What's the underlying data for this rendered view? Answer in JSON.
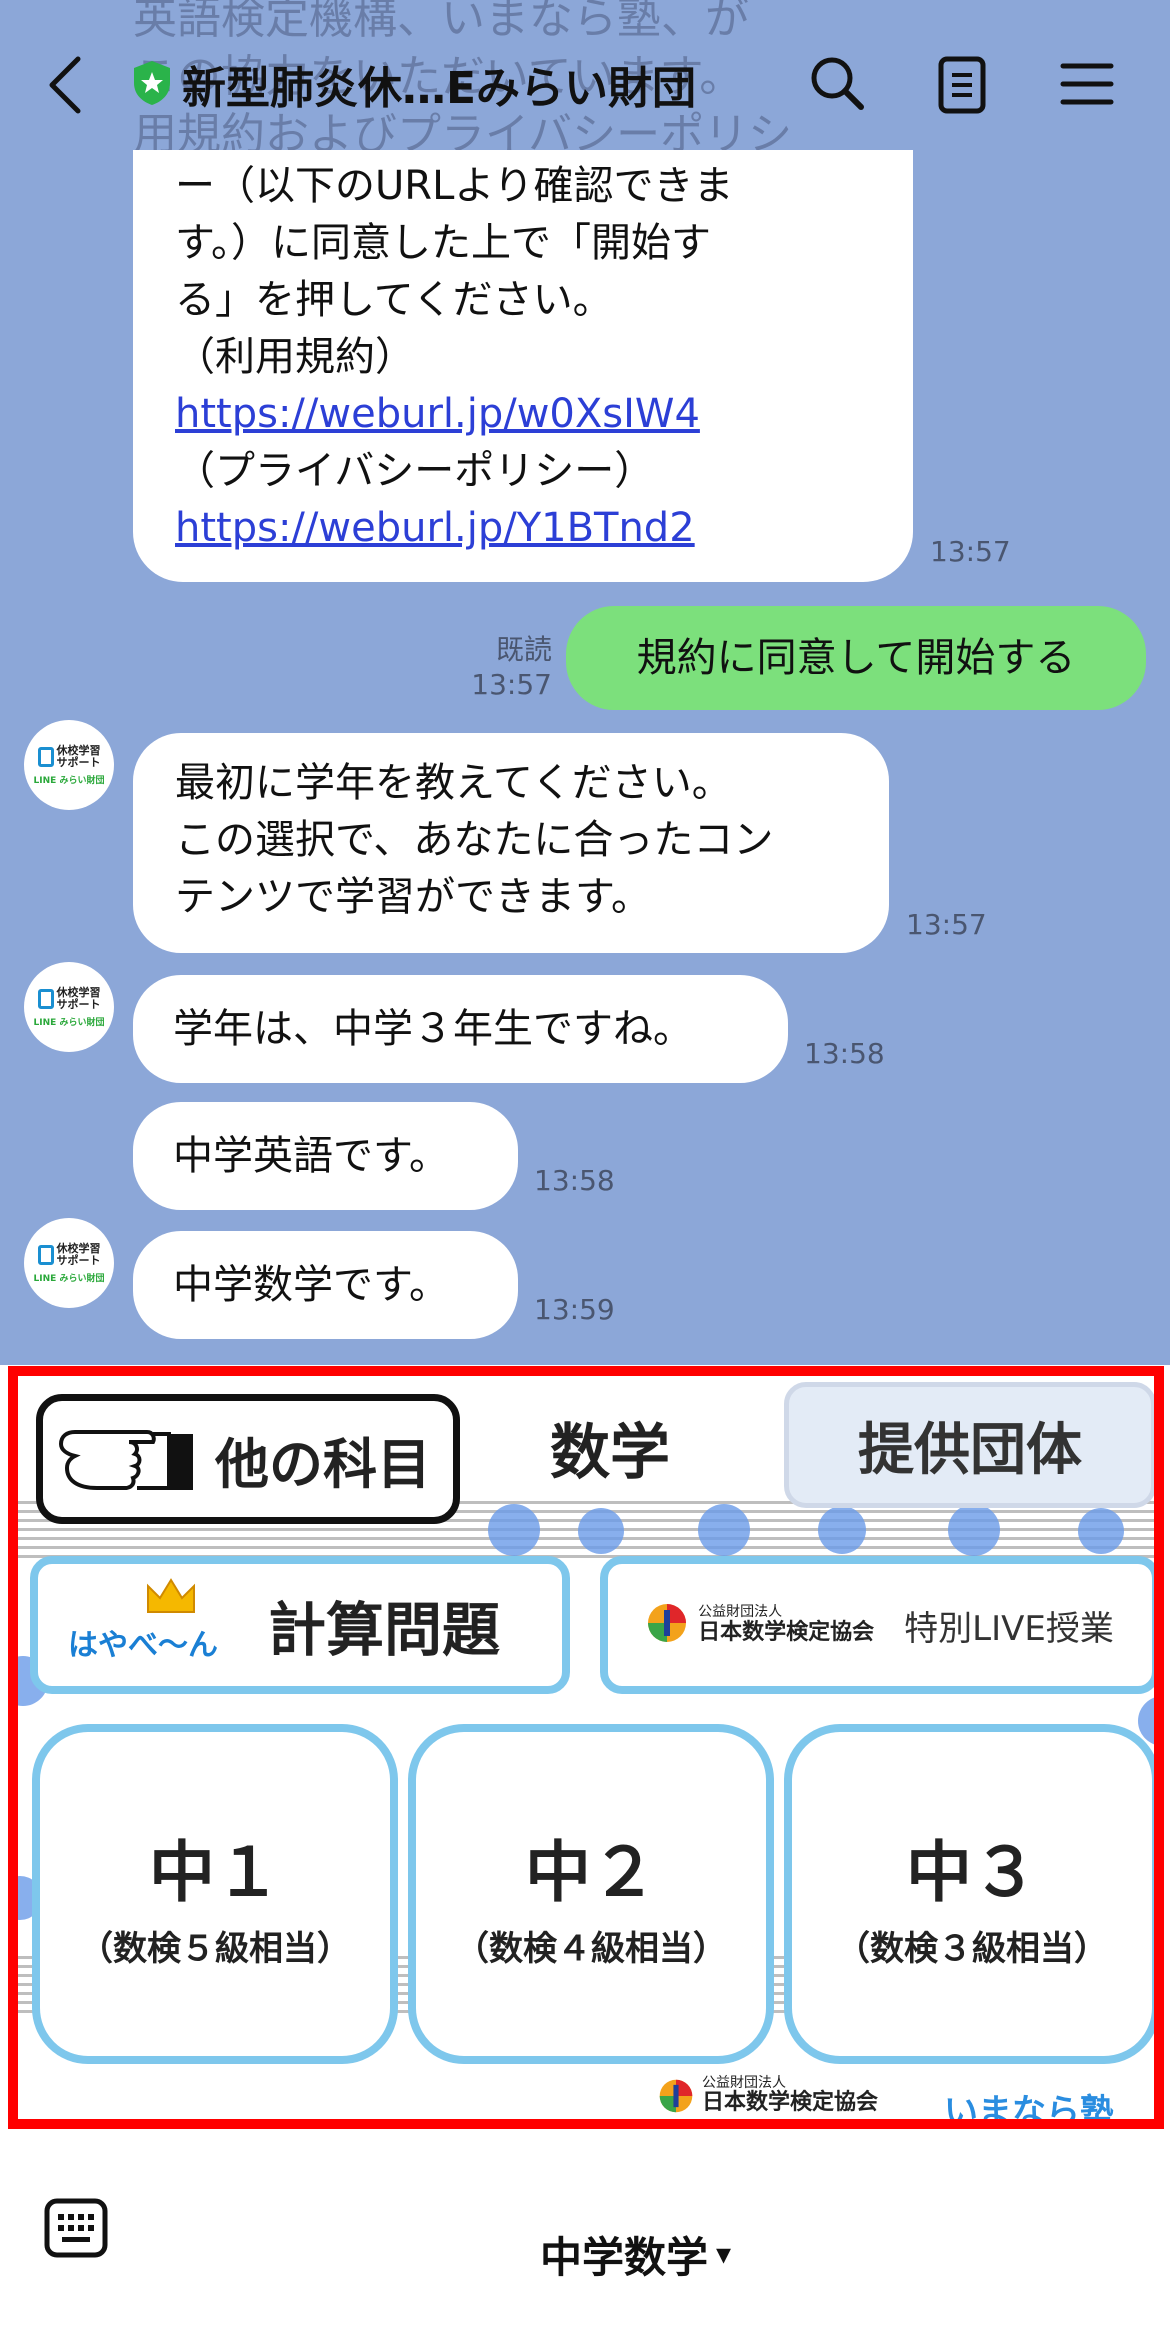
{
  "header": {
    "title": "新型肺炎休…Eみらい財団"
  },
  "chat": {
    "faded_lines": [
      "英語検定機構、いまなら塾、が",
      "この協力をいただいています。",
      "用規約およびプライバシーポリシ"
    ],
    "msg1": {
      "lines": [
        "ー（以下のURLより確認できま",
        "す。）に同意した上で「開始す",
        "る」を押してください。",
        "（利用規約）"
      ],
      "link1": "https://weburl.jp/w0XsIW4",
      "line_pp": "（プライバシーポリシー）",
      "link2": "https://weburl.jp/Y1BTnd2",
      "time": "13:57"
    },
    "msg_out": {
      "text": "規約に同意して開始する",
      "read": "既読",
      "time": "13:57"
    },
    "msg2": {
      "lines": [
        "最初に学年を教えてください。",
        "この選択で、あなたに合ったコン",
        "テンツで学習ができます。"
      ],
      "time": "13:57"
    },
    "msg3": {
      "text": "学年は、中学３年生ですね。",
      "time": "13:58"
    },
    "msg4": {
      "text": "中学英語です。",
      "time": "13:58"
    },
    "msg5": {
      "text": "中学数学です。",
      "time": "13:59"
    },
    "avatar": {
      "line1": "休校学習",
      "line2": "サポート",
      "line3": "LINE みらい財団"
    }
  },
  "rich_menu": {
    "other_subjects": "他の科目",
    "subject_title": "数学",
    "provider": "提供団体",
    "hayaben_logo": "はやべ〜ん",
    "calc_label": "計算問題",
    "org_small": "公益財団法人",
    "org_name": "日本数学検定協会",
    "live_label": "特別LIVE授業",
    "grades": [
      {
        "name": "中１",
        "sub": "（数検５級相当）"
      },
      {
        "name": "中２",
        "sub": "（数検４級相当）"
      },
      {
        "name": "中３",
        "sub": "（数検３級相当）"
      }
    ],
    "footer_org_small": "公益財団法人",
    "footer_org": "日本数学検定協会",
    "footer_logo": "いまなら塾"
  },
  "bottom_bar": {
    "menu_label": "中学数学",
    "arrow": "▾"
  },
  "colors": {
    "chat_bg": "#8ca7d8",
    "out_bubble": "#7ce07c",
    "menu_border": "#ff0000",
    "button_border": "#7ec7ec",
    "link": "#2c3fd6"
  }
}
